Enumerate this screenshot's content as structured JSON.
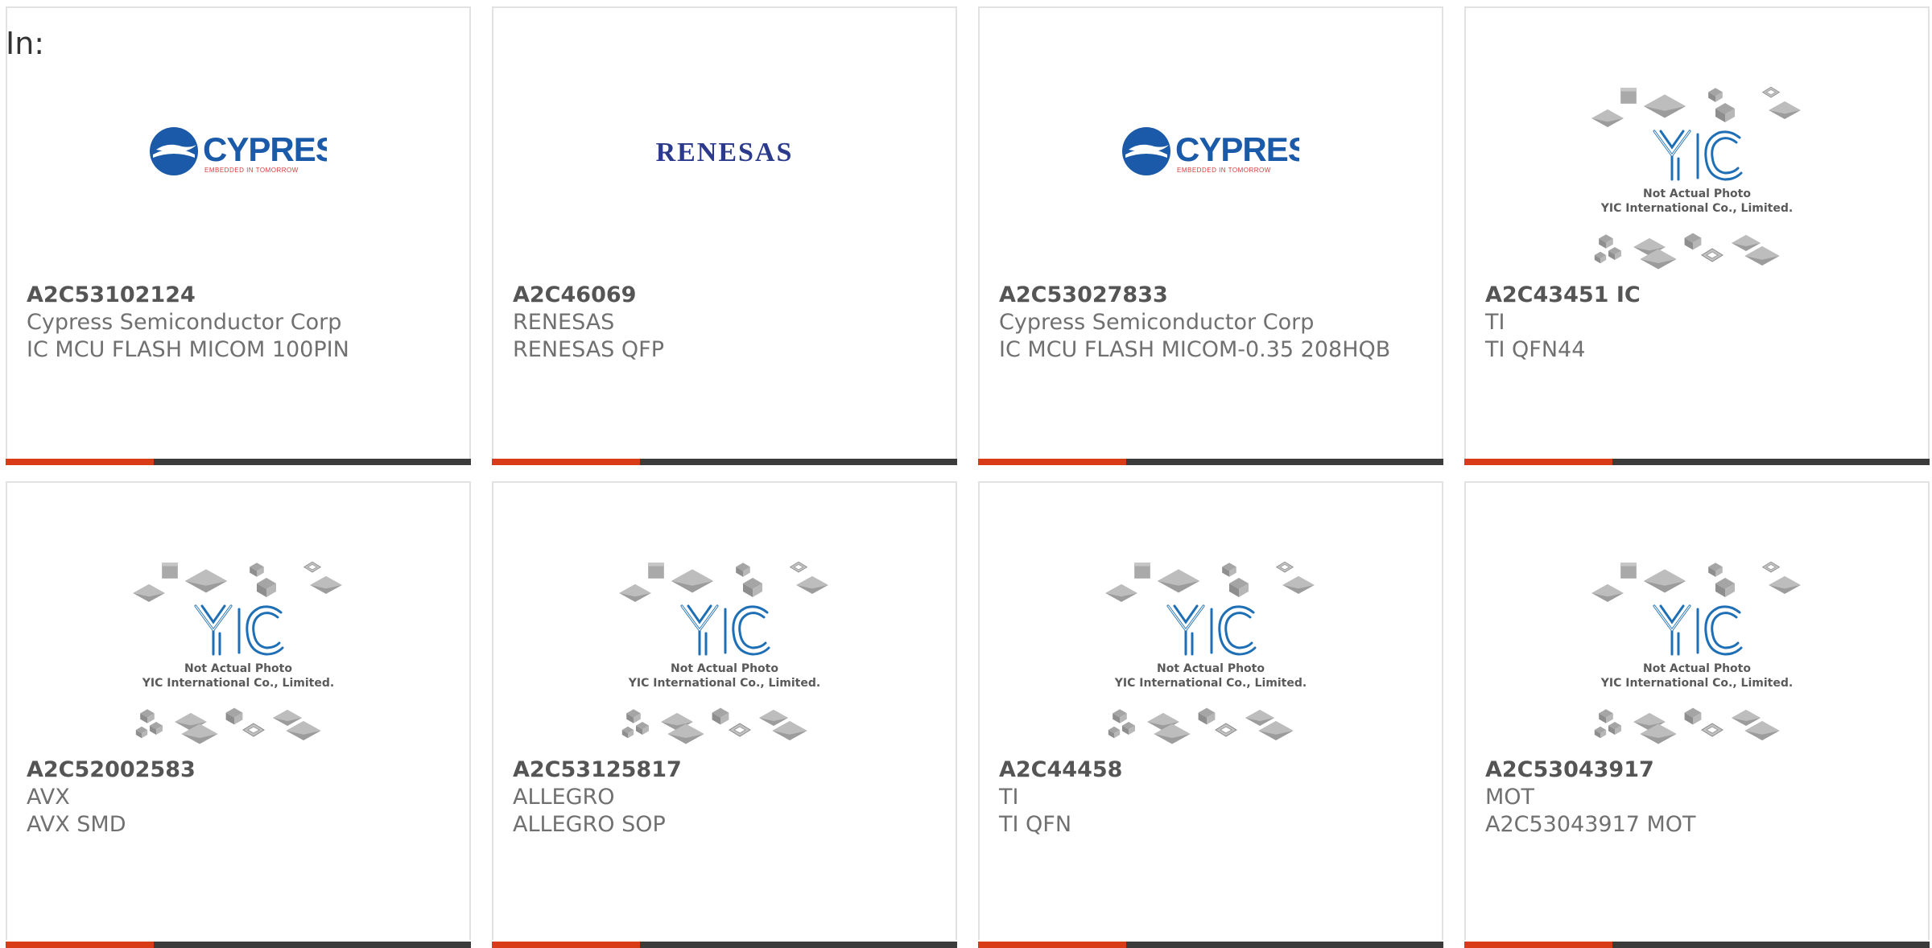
{
  "filter": {
    "prefix_label": "In:"
  },
  "placeholder": {
    "line1": "Not Actual Photo",
    "line2": "YIC International Co., Limited."
  },
  "logos": {
    "cypress_brand": "CYPRESS",
    "cypress_tagline": "EMBEDDED IN TOMORROW",
    "renesas_brand": "RENESAS"
  },
  "colors": {
    "accent": "#d83b16",
    "bar": "#3b3b3b",
    "cypress_blue": "#1b5aa8",
    "renesas_navy": "#2c3a8c",
    "yic_blue": "#1e6fb5"
  },
  "products": [
    {
      "part_number": "A2C53102124",
      "manufacturer": "Cypress Semiconductor Corp",
      "description": "IC MCU FLASH MICOM 100PIN",
      "image": "cypress-logo"
    },
    {
      "part_number": "A2C46069",
      "manufacturer": "RENESAS",
      "description": "RENESAS QFP",
      "image": "renesas-logo"
    },
    {
      "part_number": "A2C53027833",
      "manufacturer": "Cypress Semiconductor Corp",
      "description": "IC MCU FLASH MICOM-0.35 208HQB",
      "image": "cypress-logo"
    },
    {
      "part_number": "A2C43451 IC",
      "manufacturer": "TI",
      "description": "TI QFN44",
      "image": "yic-placeholder"
    },
    {
      "part_number": "A2C52002583",
      "manufacturer": "AVX",
      "description": "AVX SMD",
      "image": "yic-placeholder"
    },
    {
      "part_number": "A2C53125817",
      "manufacturer": "ALLEGRO",
      "description": "ALLEGRO SOP",
      "image": "yic-placeholder"
    },
    {
      "part_number": "A2C44458",
      "manufacturer": "TI",
      "description": "TI QFN",
      "image": "yic-placeholder"
    },
    {
      "part_number": "A2C53043917",
      "manufacturer": "MOT",
      "description": "A2C53043917 MOT",
      "image": "yic-placeholder"
    }
  ]
}
